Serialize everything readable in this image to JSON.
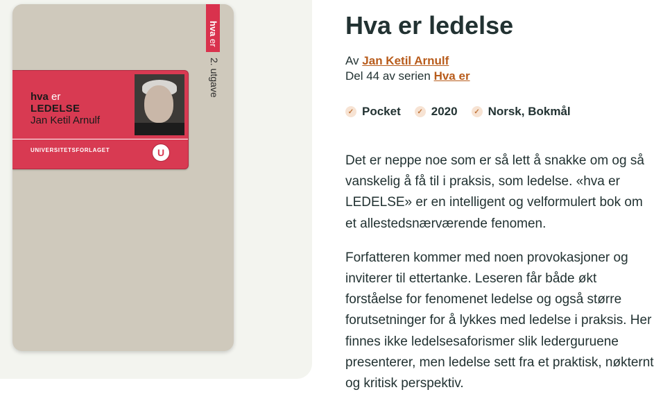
{
  "book": {
    "title": "Hva er ledelse",
    "by_prefix": "Av",
    "author": "Jan Ketil Arnulf",
    "series_prefix": "Del 44 av serien",
    "series": "Hva er",
    "meta": [
      {
        "icon": "check-icon",
        "label": "Pocket"
      },
      {
        "icon": "check-icon",
        "label": "2020"
      },
      {
        "icon": "check-icon",
        "label": "Norsk, Bokmål"
      }
    ],
    "description": [
      "Det er neppe noe som er så lett å snakke om og så vanskelig å få til i praksis, som ledelse. «hva er LEDELSE» er en intelligent og velformulert bok om et allestedsnærværende fenomen.",
      "Forfatteren kommer med noen provokasjoner og inviterer til ettertanke. Leseren får både økt forståelse for fenomenet ledelse og også større forutsetninger for å lykkes med ledelse i praksis. Her finnes ikke ledelsesaforismer slik lederguruene presenterer, men ledelse sett fra et praktisk, nøkternt og kritisk perspektiv."
    ]
  },
  "cover": {
    "series_hva": "hva",
    "series_er": "er",
    "edition": "2. utgave",
    "line1_a": "hva",
    "line1_b": "er",
    "line2": "LEDELSE",
    "author": "Jan Ketil Arnulf",
    "publisher": "UNIVERSITETSFORLAGET",
    "logo": "U"
  },
  "colors": {
    "accent_link": "#b85c1c",
    "cover_red": "#d83a52",
    "cover_bg": "#cfc9bc"
  }
}
